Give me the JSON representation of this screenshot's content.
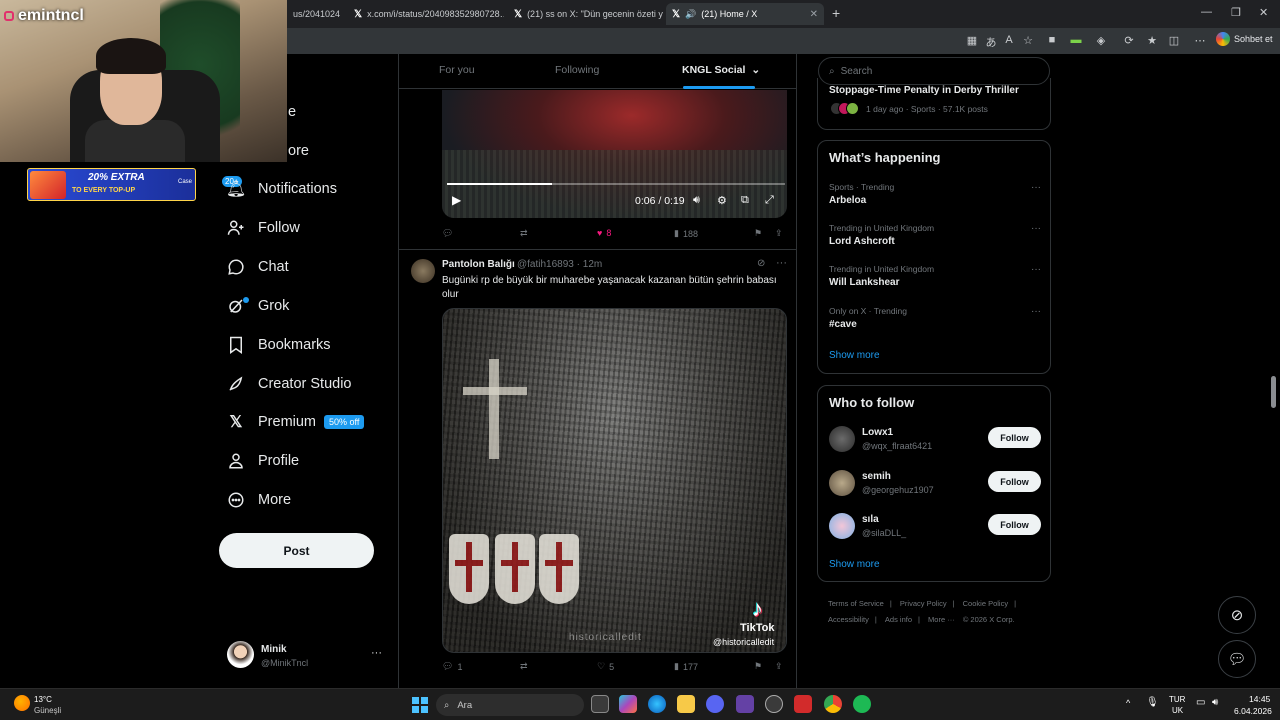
{
  "browser": {
    "tabs": [
      {
        "title": "us/2041024",
        "active": false
      },
      {
        "title": "x.com/i/status/204098352980728…",
        "active": false
      },
      {
        "title": "(21) ss on X: \"Dün gecenin özeti y…",
        "active": false
      },
      {
        "title": "(21) Home / X",
        "active": true
      }
    ],
    "sohbet_label": "Sohbet et"
  },
  "webcam": {
    "streamer_name": "emintncl"
  },
  "ad_banner": {
    "line1": "20% EXTRA",
    "line2": "TO EVERY TOP-UP",
    "brand": "Case"
  },
  "nav": {
    "partial_explore": "e",
    "partial_more": "ore",
    "notifications_badge": "20+",
    "items": [
      {
        "label": "Notifications",
        "icon": "bell-icon"
      },
      {
        "label": "Follow",
        "icon": "person-plus-icon"
      },
      {
        "label": "Chat",
        "icon": "chat-icon"
      },
      {
        "label": "Grok",
        "icon": "grok-icon"
      },
      {
        "label": "Bookmarks",
        "icon": "bookmark-icon"
      },
      {
        "label": "Creator Studio",
        "icon": "rocket-icon"
      },
      {
        "label": "Premium",
        "icon": "x-logo-icon"
      },
      {
        "label": "Profile",
        "icon": "person-icon"
      },
      {
        "label": "More",
        "icon": "more-circle-icon"
      }
    ],
    "premium_badge": "50% off",
    "post_button": "Post",
    "account": {
      "name": "Minik",
      "handle": "@MinikTncl"
    }
  },
  "feed": {
    "tabs": [
      "For you",
      "Following",
      "KNGL Social"
    ],
    "active_tab": "KNGL Social",
    "video1": {
      "time": "0:06 / 0:19",
      "progress": 0.31
    },
    "post1_actions": {
      "likes": "8",
      "views": "188"
    },
    "post2": {
      "name": "Pantolon Balığı",
      "handle": "@fatih16893",
      "time": "12m",
      "text": "Bugünki rp de büyük bir muharebe yaşanacak kazanan bütün şehrin babası olur",
      "tiktok_label": "TikTok",
      "tiktok_handle": "@historicalledit",
      "media_watermark": "historicalledit",
      "replies": "1",
      "likes": "5",
      "views": "177"
    }
  },
  "right": {
    "search_placeholder": "Search",
    "news": {
      "headline": "Stoppage-Time Penalty in Derby Thriller",
      "meta": "1 day ago · Sports · 57.1K posts"
    },
    "happening_title": "What’s happening",
    "trends": [
      {
        "context": "Sports · Trending",
        "name": "Arbeloa"
      },
      {
        "context": "Trending in United Kingdom",
        "name": "Lord Ashcroft"
      },
      {
        "context": "Trending in United Kingdom",
        "name": "Will Lankshear"
      },
      {
        "context": "Only on X · Trending",
        "name": "#cave"
      }
    ],
    "show_more": "Show more",
    "who_to_follow_title": "Who to follow",
    "who_to_follow": [
      {
        "name": "Lowx1",
        "handle": "@wqx_flraat6421",
        "button": "Follow"
      },
      {
        "name": "semih",
        "handle": "@georgehuz1907",
        "button": "Follow"
      },
      {
        "name": "sıla",
        "handle": "@silaDLL_",
        "button": "Follow"
      }
    ],
    "footer": {
      "terms": "Terms of Service",
      "privacy": "Privacy Policy",
      "cookie": "Cookie Policy",
      "accessibility": "Accessibility",
      "ads": "Ads info",
      "more": "More ···",
      "copyright": "© 2026 X Corp."
    }
  },
  "taskbar": {
    "temp": "13°C",
    "weather": "Güneşli",
    "search_label": "Ara",
    "lang1": "TUR",
    "lang2": "UK",
    "time": "14:45",
    "date": "6.04.2026"
  }
}
